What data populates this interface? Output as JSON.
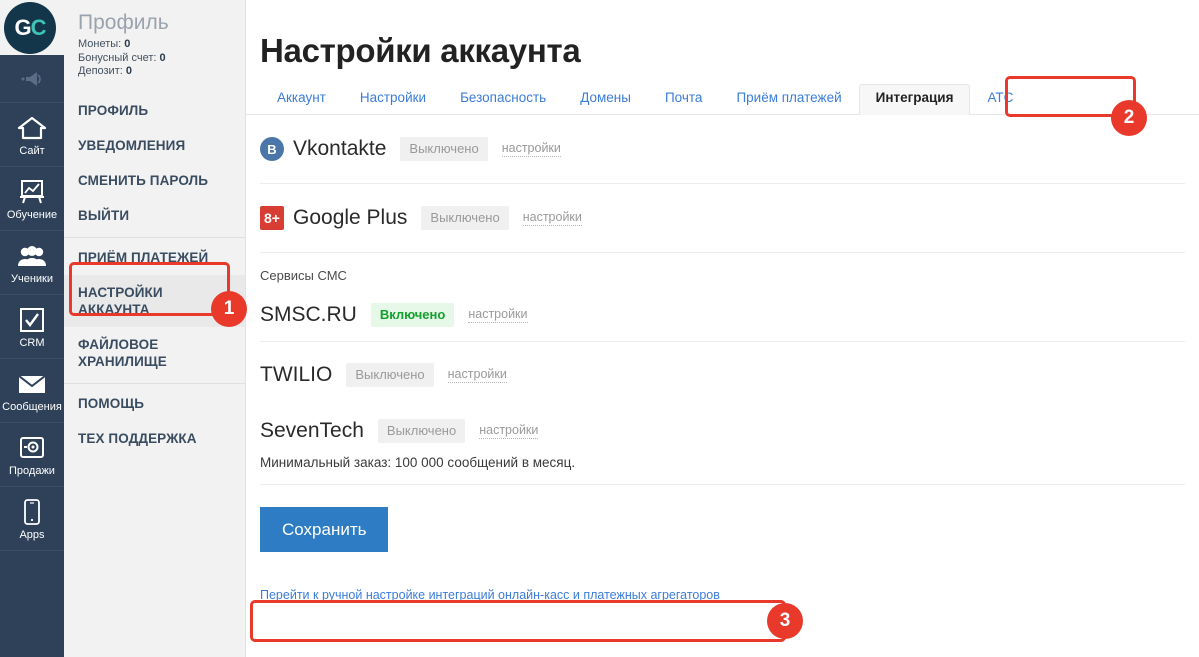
{
  "logo": {
    "part1": "G",
    "part2": "C",
    "name": "gc-logo"
  },
  "rail": {
    "items": [
      {
        "label": "",
        "icon": "megaphone-icon",
        "name": "rail-item-announcements"
      },
      {
        "label": "Сайт",
        "icon": "house-icon",
        "name": "rail-item-site"
      },
      {
        "label": "Обучение",
        "icon": "easel-chart-icon",
        "name": "rail-item-training"
      },
      {
        "label": "Ученики",
        "icon": "people-icon",
        "name": "rail-item-students"
      },
      {
        "label": "CRM",
        "icon": "checkbox-icon",
        "name": "rail-item-crm"
      },
      {
        "label": "Сообщения",
        "icon": "envelope-icon",
        "name": "rail-item-messages"
      },
      {
        "label": "Продажи",
        "icon": "safe-icon",
        "name": "rail-item-sales"
      },
      {
        "label": "Apps",
        "icon": "phone-icon",
        "name": "rail-item-apps"
      }
    ]
  },
  "profile": {
    "title": "Профиль",
    "stats": [
      {
        "label": "Монеты:",
        "value": "0"
      },
      {
        "label": "Бонусный счет:",
        "value": "0"
      },
      {
        "label": "Депозит:",
        "value": "0"
      }
    ]
  },
  "nav": {
    "items": [
      {
        "label": "ПРОФИЛЬ",
        "active": false,
        "sep": false
      },
      {
        "label": "УВЕДОМЛЕНИЯ",
        "active": false,
        "sep": false
      },
      {
        "label": "СМЕНИТЬ ПАРОЛЬ",
        "active": false,
        "sep": false
      },
      {
        "label": "ВЫЙТИ",
        "active": false,
        "sep": false
      },
      {
        "label": "ПРИЁМ ПЛАТЕЖЕЙ",
        "active": false,
        "sep": true
      },
      {
        "label": "НАСТРОЙКИ АККАУНТА",
        "active": true,
        "sep": false
      },
      {
        "label": "ФАЙЛОВОЕ ХРАНИЛИЩЕ",
        "active": false,
        "sep": false
      },
      {
        "label": "ПОМОЩЬ",
        "active": false,
        "sep": true
      },
      {
        "label": "ТЕХ ПОДДЕРЖКА",
        "active": false,
        "sep": false
      }
    ]
  },
  "main": {
    "title": "Настройки аккаунта",
    "tabs": [
      {
        "label": "Аккаунт",
        "active": false
      },
      {
        "label": "Настройки",
        "active": false
      },
      {
        "label": "Безопасность",
        "active": false
      },
      {
        "label": "Домены",
        "active": false
      },
      {
        "label": "Почта",
        "active": false
      },
      {
        "label": "Приём платежей",
        "active": false
      },
      {
        "label": "Интеграция",
        "active": true
      },
      {
        "label": "АТС",
        "active": false
      }
    ],
    "social": [
      {
        "name": "Vkontakte",
        "icon_glyph": "В",
        "icon_kind": "vk",
        "state": "Выключено",
        "state_kind": "off",
        "settings_label": "настройки"
      },
      {
        "name": "Google Plus",
        "icon_glyph": "8+",
        "icon_kind": "gp",
        "state": "Выключено",
        "state_kind": "off",
        "settings_label": "настройки"
      }
    ],
    "sms_section_label": "Сервисы СМС",
    "sms": [
      {
        "name": "SMSC.RU",
        "state": "Включено",
        "state_kind": "on",
        "settings_label": "настройки",
        "note": ""
      },
      {
        "name": "TWILIO",
        "state": "Выключено",
        "state_kind": "off",
        "settings_label": "настройки",
        "note": ""
      },
      {
        "name": "SevenTech",
        "state": "Выключено",
        "state_kind": "off",
        "settings_label": "настройки",
        "note": "Минимальный заказ: 100 000 сообщений в месяц."
      }
    ],
    "save_label": "Сохранить",
    "manual_link": "Перейти к ручной настройке интеграций онлайн-касс и платежных агрегаторов"
  },
  "annotations": [
    {
      "number": "1",
      "target": "Настройки аккаунта (боковое меню)"
    },
    {
      "number": "2",
      "target": "Интеграция (вкладка)"
    },
    {
      "number": "3",
      "target": "Ручная настройка интеграций (ссылка)"
    }
  ],
  "colors": {
    "rail_bg": "#2e4159",
    "nav_bg": "#f2f2f2",
    "accent_link": "#3b7dd8",
    "annotation": "#e8392b",
    "enabled_green": "#14a02c",
    "save_blue": "#2d7cc4"
  }
}
